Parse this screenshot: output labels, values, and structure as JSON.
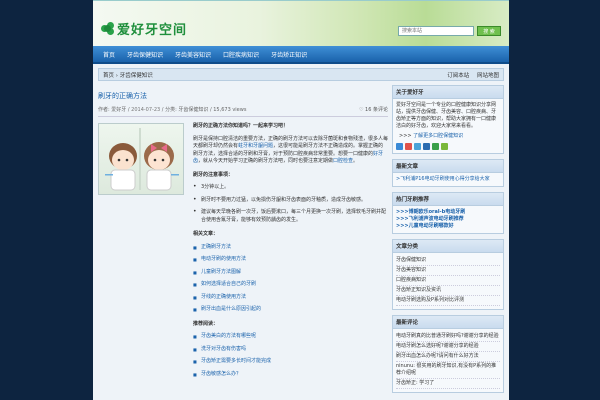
{
  "header": {
    "logo_text": "爱好牙空间",
    "search_placeholder": "搜索本站",
    "search_button": "搜 索"
  },
  "nav": [
    "首页",
    "牙齿保健知识",
    "牙齿美容知识",
    "口腔疾病知识",
    "牙齿矫正知识"
  ],
  "breadcrumb": {
    "path": "首页 › 牙齿保健知识",
    "links": [
      "订阅本站",
      "网站地图"
    ]
  },
  "post": {
    "title": "刷牙的正确方法",
    "meta_author": "作者: 爱好牙",
    "meta_date": "2014-07-23",
    "meta_cat": "分类: 牙齿保健知识",
    "meta_views": "15,673 views",
    "comments": "16 条评论",
    "intro": "刷牙的正确方法你知道吗？一起来学习吧！",
    "para1a": "刷牙是保持口腔清洁的重要方法，正确的刷牙方法可以去除牙菌斑和食物残渣，很多人每天都刷牙却仍然会有",
    "para1_link1": "蛀牙和牙龈问题",
    "para1b": "，这很可能是刷牙方法不正确造成的。掌握正确的刷牙方法，选择合适的牙刷和牙膏，对于预防口腔疾病非常重要。想要一口健康的",
    "para1_link2": "好牙齿",
    "para1c": "，就从今天开始学习正确的刷牙方法吧，同时也要注意定期做",
    "para1_link3": "口腔检查",
    "para1d": "。",
    "tips_title": "刷牙的注意事项：",
    "tips": [
      "3分钟以上。",
      "刷牙时不要用力过猛，以免损伤牙龈和牙齿表面的牙釉质，造成牙齿敏感。",
      "建议每天早晚各刷一次牙，饭后要漱口，每三个月更换一次牙刷，选择软毛牙刷并配合使用含氟牙膏，能够有效预防龋齿的发生。"
    ],
    "related_title": "相关文章：",
    "related": [
      "正确刷牙方法",
      "电动牙刷的使用方法",
      "儿童刷牙方法图解",
      "如何选择适合自己的牙刷",
      "牙线的正确使用方法",
      "刷牙出血是什么原因引起的"
    ],
    "recommend_title": "推荐阅读：",
    "recommend": [
      "牙齿美白的方法有哪些呢",
      "洗牙对牙齿有伤害吗",
      "牙齿矫正需要多长时间才能完成",
      "牙齿敏感怎么办？"
    ]
  },
  "sidebar": {
    "about_title": "关于爱好牙",
    "about_text": "爱好牙空间是一个专业的口腔健康知识分享网站，提供牙齿保健、牙齿美容、口腔疾病、牙齿矫正等方面的知识，帮助大家拥有一口健康洁白的好牙齿，欢迎大家常来看看。",
    "about_more": ">>>",
    "about_more_link": "了解更多口腔保健知识",
    "recent_title": "最新文章",
    "recent_link": ">飞利浦P16电动牙刷使用心得分享给大家",
    "hot_title": "热门牙刷推荐",
    "hot": [
      ">>>博朗欧乐oral-b电动牙刷",
      ">>>飞利浦声波电动牙刷推荐",
      ">>>儿童电动牙刷哪款好"
    ],
    "cats_title": "文章分类",
    "cats": [
      "牙齿保健知识",
      "牙齿美容知识",
      "口腔疾病知识",
      "牙齿矫正知识及资讯",
      "电动牙刷选购及P系列对比评测"
    ],
    "rec_title": "最新评论",
    "rec": [
      "电动牙刷真的比普通牙刷好吗?谢谢分享的经验",
      "电动牙刷怎么选好呢?谢谢分享的经验",
      "刷牙出血怎么办呢?请问有什么好方法",
      "ninunu: 很实用的刷牙知识,有没有P系列的推荐介绍呢",
      "牙齿矫正: 学习了"
    ]
  },
  "colors": {
    "nav": "#1a62ab",
    "link": "#1a62ab",
    "accent_green": "#6fc04d",
    "background": "#0d2440"
  }
}
